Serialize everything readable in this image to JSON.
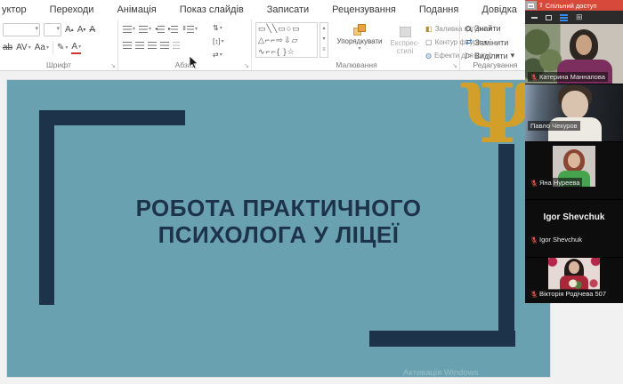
{
  "menubar": {
    "tabs": [
      {
        "label": "уктор"
      },
      {
        "label": "Переходи"
      },
      {
        "label": "Анімація"
      },
      {
        "label": "Показ слайдів"
      },
      {
        "label": "Записати"
      },
      {
        "label": "Рецензування"
      },
      {
        "label": "Подання"
      },
      {
        "label": "Довідка"
      }
    ]
  },
  "ribbon": {
    "font_group": {
      "label": "Шрифт"
    },
    "paragraph_group": {
      "label": "Абзац"
    },
    "drawing_group": {
      "label": "Малювання",
      "arrange_label": "Упорядкувати",
      "quick_styles_label": "Експрес-стилі",
      "shape_fill_label": "Заливка фігури",
      "shape_outline_label": "Контур фігури",
      "shape_effects_label": "Ефекти для фігур"
    },
    "editing_group": {
      "label": "Редагування",
      "find_label": "Знайти",
      "replace_label": "Замінити",
      "select_label": "Виділити"
    },
    "icons": {
      "strikethrough_icon": "ab",
      "character_spacing_icon": "AV",
      "change_case_icon": "Aa",
      "grow_font_icon": "A",
      "shrink_font_icon": "A",
      "clear_formatting_icon": "A",
      "ink_icon": "✎",
      "font_color_icon": "A",
      "replace_icon": "⇄",
      "select_icon": "▷"
    }
  },
  "slide": {
    "title_line1": "РОБОТА ПРАКТИЧНОГО",
    "title_line2": "ПСИХОЛОГА У ЛІЦЕЇ",
    "psi_symbol": "Ψ",
    "watermark": "Активація Windows",
    "colors": {
      "background": "#6AA1B0",
      "accent": "#1D3349",
      "gold": "#D2A02A"
    }
  },
  "meeting_panel": {
    "share_banner_label": "Спільний доступ",
    "participants": [
      {
        "name": "Катерина Маннапова",
        "muted": true
      },
      {
        "name": "Павло Чекуров",
        "muted": false
      },
      {
        "name": "Яна Нуреева",
        "muted": true
      },
      {
        "name": "Igor Shevchuk",
        "muted": true
      },
      {
        "name": "Вікторія Родічева 507",
        "muted": true
      }
    ]
  }
}
